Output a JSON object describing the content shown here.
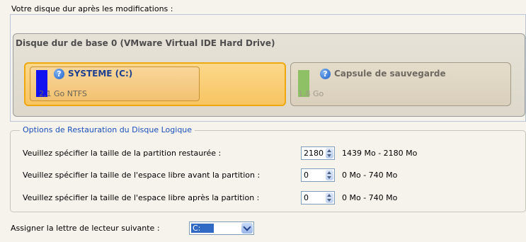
{
  "header": {
    "title": "Votre disque dur après les modifications :"
  },
  "disk": {
    "name": "Disque dur de base 0 (VMware Virtual IDE Hard Drive)",
    "partitions": [
      {
        "label": "SYSTEME (C:)",
        "size": "2,1 Go NTFS",
        "color": "#1212f0",
        "icon": "help-icon"
      },
      {
        "label": "Capsule de sauvegarde",
        "size": "1,8 Go",
        "color": "#8ec065",
        "icon": "help-icon"
      }
    ]
  },
  "options": {
    "title": "Options de Restauration du Disque Logique",
    "rows": [
      {
        "label": "Veuillez spécifier la taille de la partition restaurée :",
        "value": "2180",
        "range": "1439 Mo - 2180 Mo"
      },
      {
        "label": "Veuillez spécifier la taille de l'espace libre avant la partition :",
        "value": "0",
        "range": "0 Mo - 740 Mo"
      },
      {
        "label": "Veuillez spécifier la taille de l'espace libre après la partition :",
        "value": "0",
        "range": "0 Mo - 740 Mo"
      }
    ]
  },
  "drive": {
    "label": "Assigner la lettre de lecteur suivante :",
    "selected": "C:"
  },
  "colors": {
    "accent": "#1b4fbc",
    "system_partition": "#f7c462",
    "selection": "#316ac5"
  }
}
